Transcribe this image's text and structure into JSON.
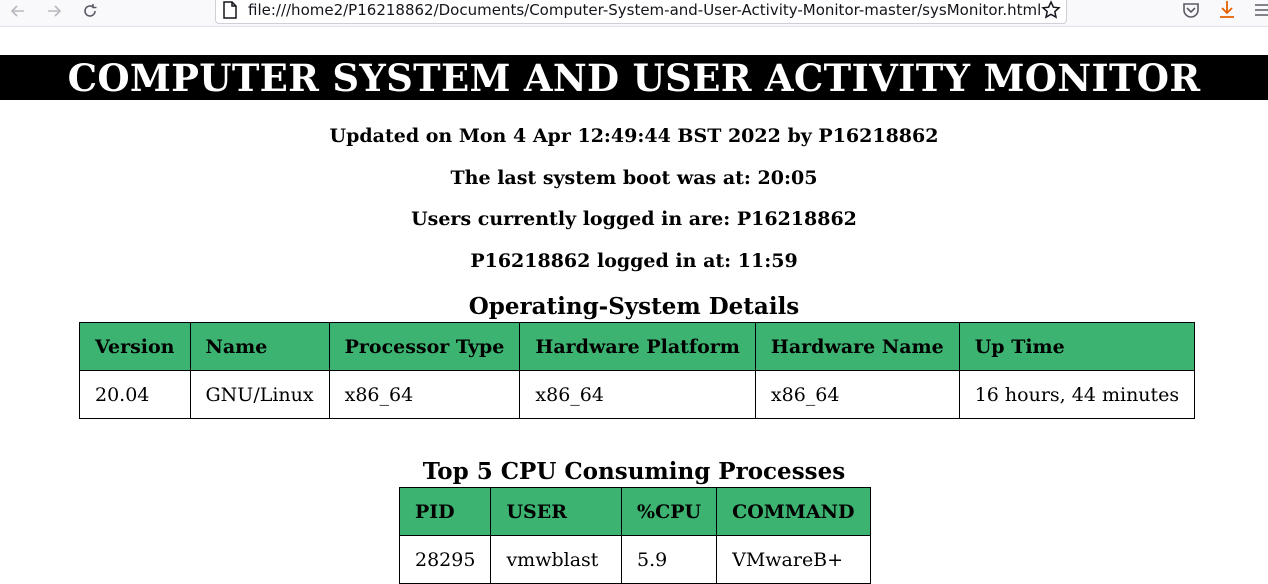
{
  "browser": {
    "url": "file:///home2/P16218862/Documents/Computer-System-and-User-Activity-Monitor-master/sysMonitor.html",
    "back_icon": "arrow-left-icon",
    "forward_icon": "arrow-right-icon",
    "reload_icon": "reload-icon"
  },
  "page": {
    "title": "COMPUTER SYSTEM AND USER ACTIVITY MONITOR",
    "updated": "Updated on Mon 4 Apr 12:49:44 BST 2022 by P16218862",
    "last_boot": "The last system boot was at: 20:05",
    "users_logged_in": "Users currently logged in are: P16218862",
    "user_login_time": "P16218862 logged in at: 11:59"
  },
  "os_details": {
    "title": "Operating-System Details",
    "headers": [
      "Version",
      "Name",
      "Processor Type",
      "Hardware Platform",
      "Hardware Name",
      "Up Time"
    ],
    "rows": [
      [
        "20.04",
        "GNU/Linux",
        "x86_64",
        "x86_64",
        "x86_64",
        "16 hours, 44 minutes"
      ]
    ]
  },
  "top_cpu": {
    "title": "Top 5 CPU Consuming Processes",
    "headers": [
      "PID",
      "USER",
      "%CPU",
      "COMMAND"
    ],
    "rows": [
      [
        "28295",
        "vmwblast",
        "5.9",
        "VMwareB+"
      ]
    ]
  },
  "colors": {
    "header_bg": "#3cb371",
    "banner_bg": "#000000"
  }
}
